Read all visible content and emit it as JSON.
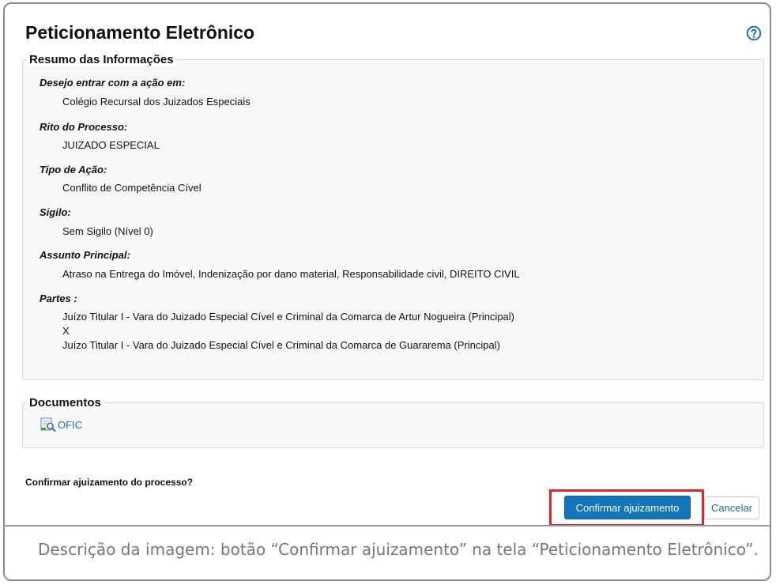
{
  "page": {
    "title": "Peticionamento Eletrônico",
    "help_icon": "question-circle-icon"
  },
  "summary": {
    "legend": "Resumo das Informações",
    "fields": [
      {
        "label": "Desejo entrar com a ação em:",
        "values": [
          "Colégio Recursal dos Juizados Especiais"
        ]
      },
      {
        "label": "Rito do Processo:",
        "values": [
          "JUIZADO ESPECIAL"
        ]
      },
      {
        "label": "Tipo de Ação:",
        "values": [
          "Conflito de Competência Cível"
        ]
      },
      {
        "label": "Sigilo:",
        "values": [
          "Sem Sigilo (Nível 0)"
        ]
      },
      {
        "label": "Assunto Principal:",
        "values": [
          "Atraso na Entrega do Imóvel, Indenização por dano material, Responsabilidade civil, DIREITO CIVIL"
        ]
      },
      {
        "label": "Partes :",
        "values": [
          "Juízo Titular I - Vara do Juizado Especial Cível e Criminal da Comarca de Artur Nogueira (Principal)",
          "X",
          "Juízo Titular I - Vara do Juizado Especial Cível e Criminal da Comarca de Guararema (Principal)"
        ]
      }
    ]
  },
  "documents": {
    "legend": "Documentos",
    "items": [
      {
        "name": "OFIC",
        "icon": "document-preview-icon"
      }
    ]
  },
  "confirm": {
    "question": "Confirmar ajuizamento do processo?",
    "confirm_label": "Confirmar ajuizamento",
    "cancel_label": "Cancelar"
  },
  "caption": "Descrição da imagem: botão “Confirmar ajuizamento” na tela “Peticionamento Eletrônico”.",
  "colors": {
    "primary_button": "#1475b8",
    "link": "#1a6fb5",
    "highlight": "#e0252b"
  }
}
